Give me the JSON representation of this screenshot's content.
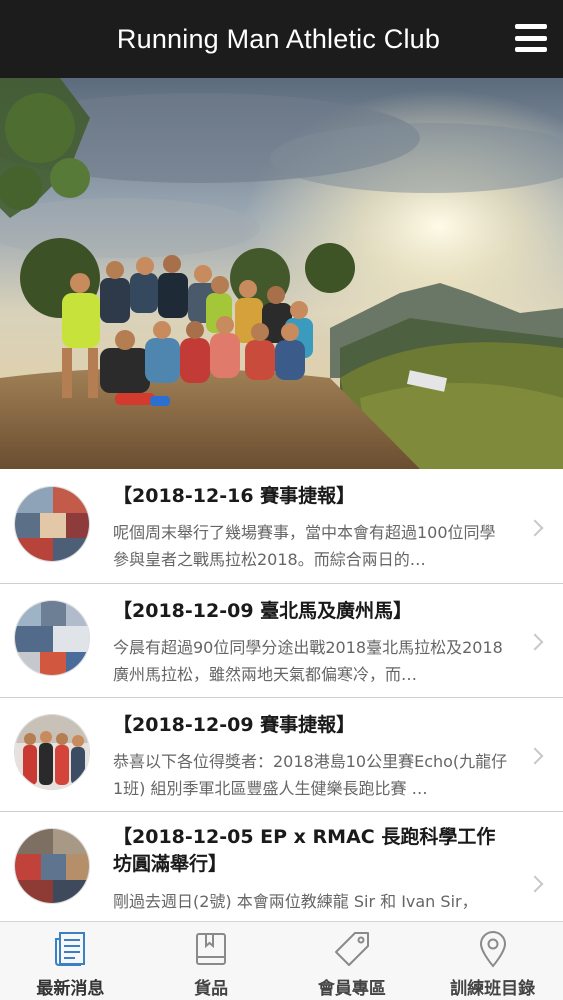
{
  "header": {
    "title": "Running Man Athletic Club",
    "menu_icon": "hamburger-menu-icon"
  },
  "hero": {
    "image": "group-of-runners-on-mountain-summit-photo"
  },
  "news": [
    {
      "title": "【2018-12-16 賽事捷報】",
      "summary": "呢個周末舉行了幾場賽事，當中本會有超過100位同學參與皇者之戰馬拉松2018。而綜合兩日的…"
    },
    {
      "title": "【2018-12-09 臺北馬及廣州馬】",
      "summary": "今晨有超過90位同學分途出戰2018臺北馬拉松及2018廣州馬拉松，雖然兩地天氣都偏寒冷，而…"
    },
    {
      "title": "【2018-12-09 賽事捷報】",
      "summary": "恭喜以下各位得獎者：2018港島10公里賽Echo(九龍仔1班) 組別季軍北區豐盛人生健樂長跑比賽 …"
    },
    {
      "title": "【2018-12-05 EP x RMAC 長跑科學工作坊圓滿舉行】",
      "summary": "剛過去週日(2號) 本會兩位教練龍 Sir 和 Ivan Sir，"
    }
  ],
  "tabs": [
    {
      "label": "最新消息",
      "icon": "newspaper-icon",
      "color": "#3b7fc4"
    },
    {
      "label": "貨品",
      "icon": "book-icon",
      "color": "#8a8a8a"
    },
    {
      "label": "會員專區",
      "icon": "tag-icon",
      "color": "#8a8a8a"
    },
    {
      "label": "訓練班目錄",
      "icon": "map-pin-icon",
      "color": "#8a8a8a"
    }
  ]
}
